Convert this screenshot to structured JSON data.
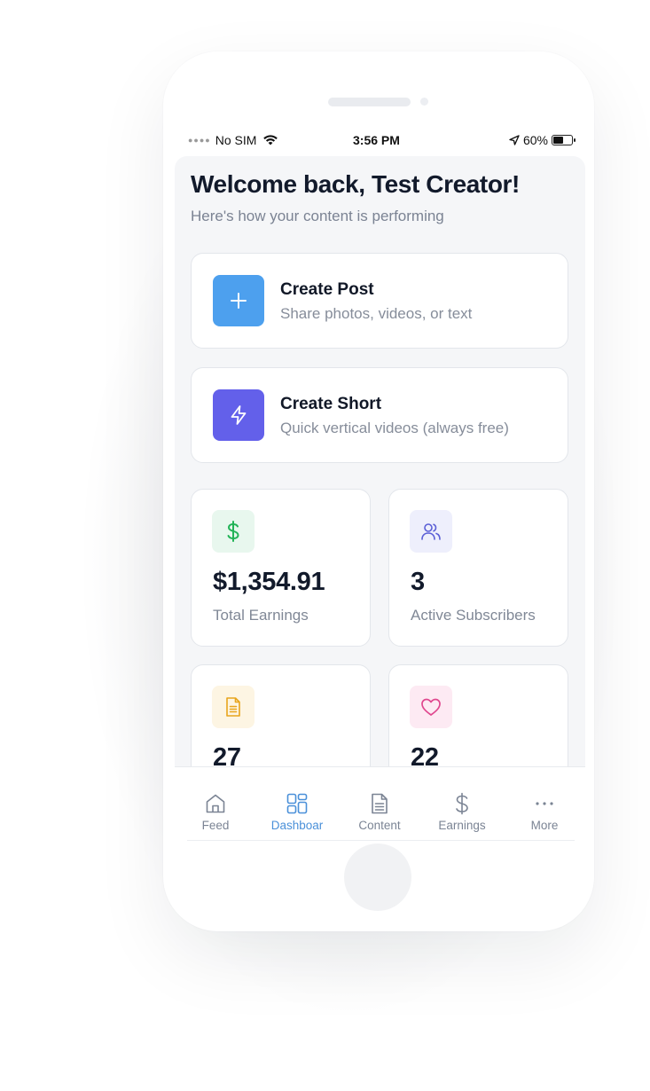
{
  "status_bar": {
    "carrier": "No SIM",
    "time": "3:56 PM",
    "battery_percent": "60%",
    "battery_level": 0.6,
    "icons": [
      "wifi-icon",
      "location-arrow-icon",
      "battery-icon"
    ]
  },
  "header": {
    "title": "Welcome back, Test Creator!",
    "subtitle": "Here's how your content is performing"
  },
  "actions": [
    {
      "title": "Create Post",
      "description": "Share photos, videos, or text",
      "icon": "plus-icon",
      "color": "#4da0ee"
    },
    {
      "title": "Create Short",
      "description": "Quick vertical videos (always free)",
      "icon": "lightning-icon",
      "color": "#6360ea"
    }
  ],
  "stats": [
    {
      "value": "$1,354.91",
      "label": "Total Earnings",
      "icon": "dollar-icon",
      "icon_color": "#22b357",
      "bg_color": "#e8f7ee"
    },
    {
      "value": "3",
      "label": "Active Subscribers",
      "icon": "users-icon",
      "icon_color": "#5b5fd6",
      "bg_color": "#eeeffc"
    },
    {
      "value": "27",
      "label": "",
      "icon": "document-icon",
      "icon_color": "#e8a51c",
      "bg_color": "#fdf5e3"
    },
    {
      "value": "22",
      "label": "",
      "icon": "heart-icon",
      "icon_color": "#e0478e",
      "bg_color": "#fdeaf3"
    }
  ],
  "tabs": [
    {
      "label": "Feed",
      "icon": "home-icon",
      "active": false
    },
    {
      "label": "Dashboar",
      "icon": "dashboard-icon",
      "active": true
    },
    {
      "label": "Content",
      "icon": "document-icon",
      "active": false
    },
    {
      "label": "Earnings",
      "icon": "dollar-icon",
      "active": false
    },
    {
      "label": "More",
      "icon": "more-icon",
      "active": false
    }
  ],
  "colors": {
    "active_tab": "#4a90d9",
    "inactive_tab": "#7b8494",
    "screen_background": "#f5f6f8"
  }
}
